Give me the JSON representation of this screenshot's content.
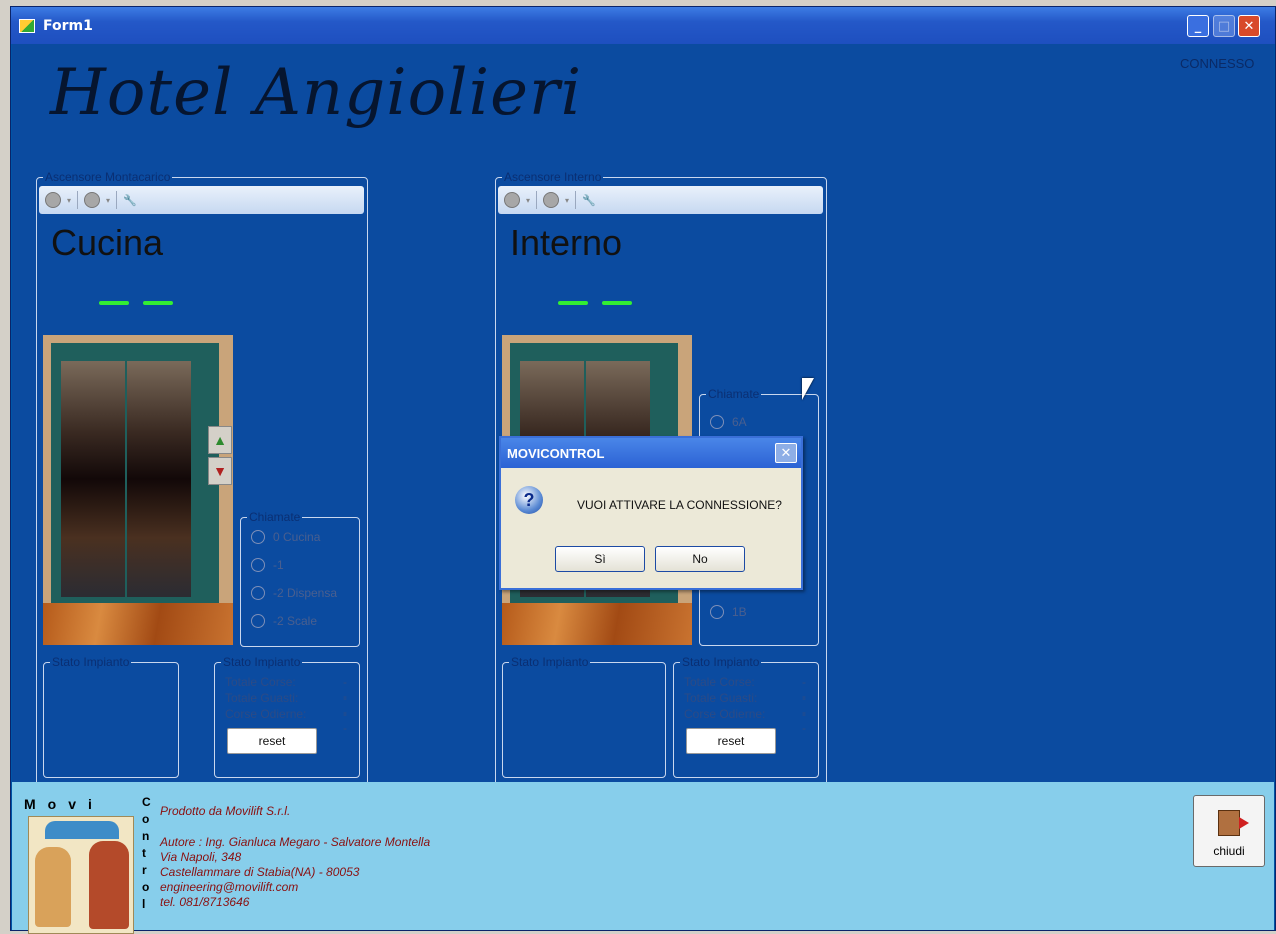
{
  "window": {
    "title": "Form1",
    "minimize": "_",
    "maximize": "□",
    "close": "✕"
  },
  "header": {
    "hotel_name": "Hotel Angiolieri",
    "connection_status": "CONNESSO"
  },
  "toolbar": {
    "arrow": "▾",
    "stop_icon": "stop-icon",
    "circle_icon": "circle-icon",
    "wrench_icon": "wrench-icon"
  },
  "elevators": [
    {
      "group_label": "Ascensore Montacarico",
      "car_name": "Cucina",
      "calls_label": "Chiamate",
      "calls": [
        "0 Cucina",
        "-1",
        "-2 Dispensa",
        "-2 Scale"
      ],
      "plant_status_left": "Stato Impianto",
      "plant_status_right": "Stato Impianto",
      "stats": [
        {
          "label": "Totale Corse:",
          "value": "--"
        },
        {
          "label": "Totale Guasti:",
          "value": "--"
        },
        {
          "label": "Corse Odierne:",
          "value": "--"
        }
      ],
      "reset": "reset",
      "up_icon": "up-arrow-icon",
      "down_icon": "down-arrow-icon"
    },
    {
      "group_label": "Ascensore Interno",
      "car_name": "Interno",
      "calls_label": "Chiamate",
      "calls": [
        "6A",
        "1B"
      ],
      "plant_status_left": "Stato Impianto",
      "plant_status_right": "Stato Impianto",
      "stats": [
        {
          "label": "Totale Corse:",
          "value": "--"
        },
        {
          "label": "Totale Guasti:",
          "value": "--"
        },
        {
          "label": "Corse Odierne:",
          "value": "--"
        }
      ],
      "reset": "reset"
    }
  ],
  "dialog": {
    "title": "MOVICONTROL",
    "close": "✕",
    "icon": "?",
    "message": "VUOI ATTIVARE LA CONNESSIONE?",
    "yes": "Sì",
    "no": "No"
  },
  "footer": {
    "logo_top": [
      "M",
      "o",
      "v",
      "i"
    ],
    "logo_side": [
      "C",
      "o",
      "n",
      "t",
      "r",
      "o",
      "l"
    ],
    "produced_by": "Prodotto da Movilift S.r.l.",
    "authors": "Autore : Ing. Gianluca Megaro - Salvatore Montella",
    "address1": "Via Napoli, 348",
    "address2": "Castellammare di Stabia(NA) - 80053",
    "email": "engineering@movilift.com",
    "phone": "tel. 081/8713646",
    "close_button": "chiudi"
  }
}
